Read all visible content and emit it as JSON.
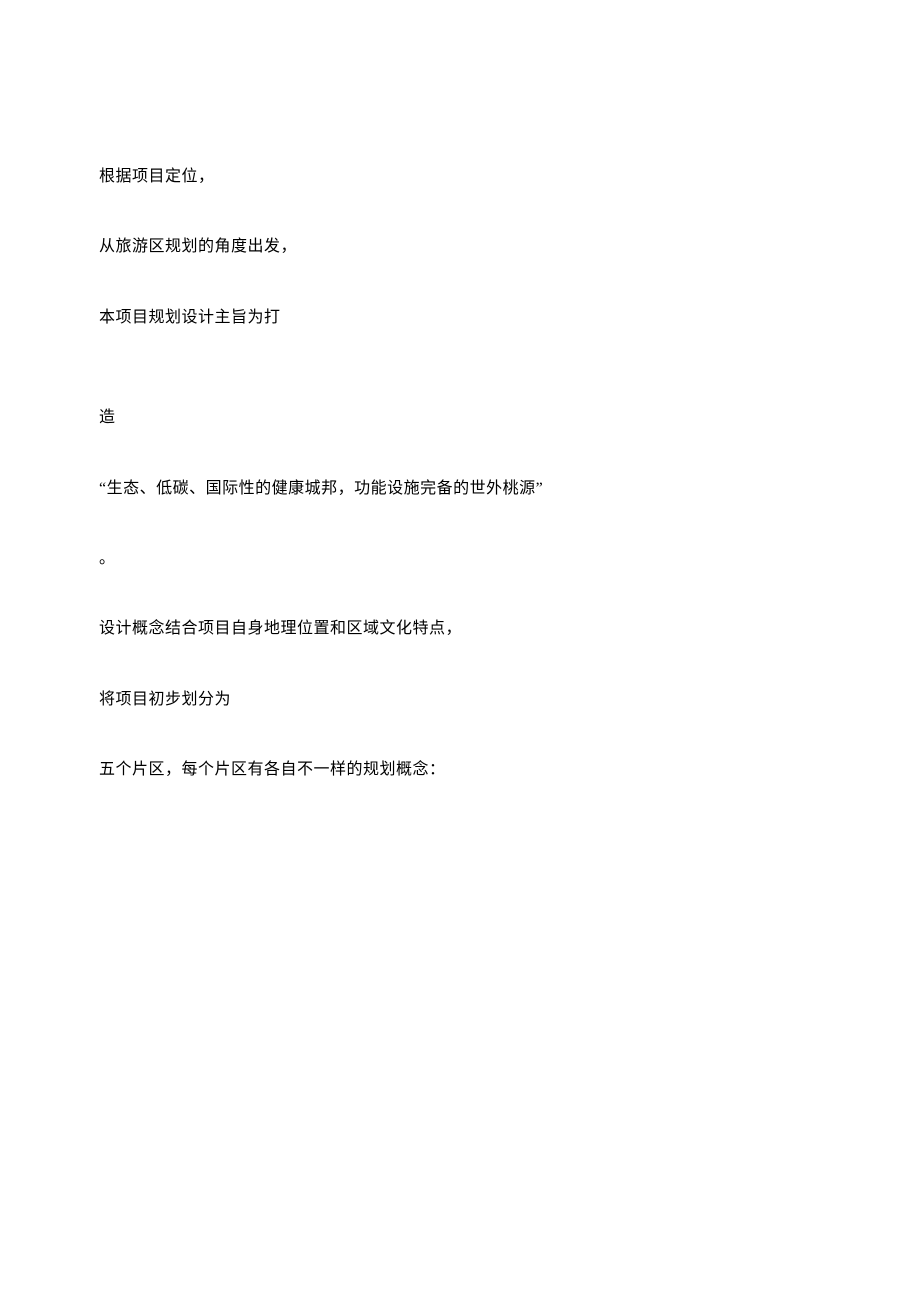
{
  "paragraphs": [
    "根据项目定位，",
    "从旅游区规划的角度出发，",
    "本项目规划设计主旨为打",
    "造",
    "“生态、低碳、国际性的健康城邦，功能设施完备的世外桃源”",
    "。",
    "设计概念结合项目自身地理位置和区域文化特点，",
    "将项目初步划分为",
    "五个片区，每个片区有各自不一样的规划概念："
  ]
}
